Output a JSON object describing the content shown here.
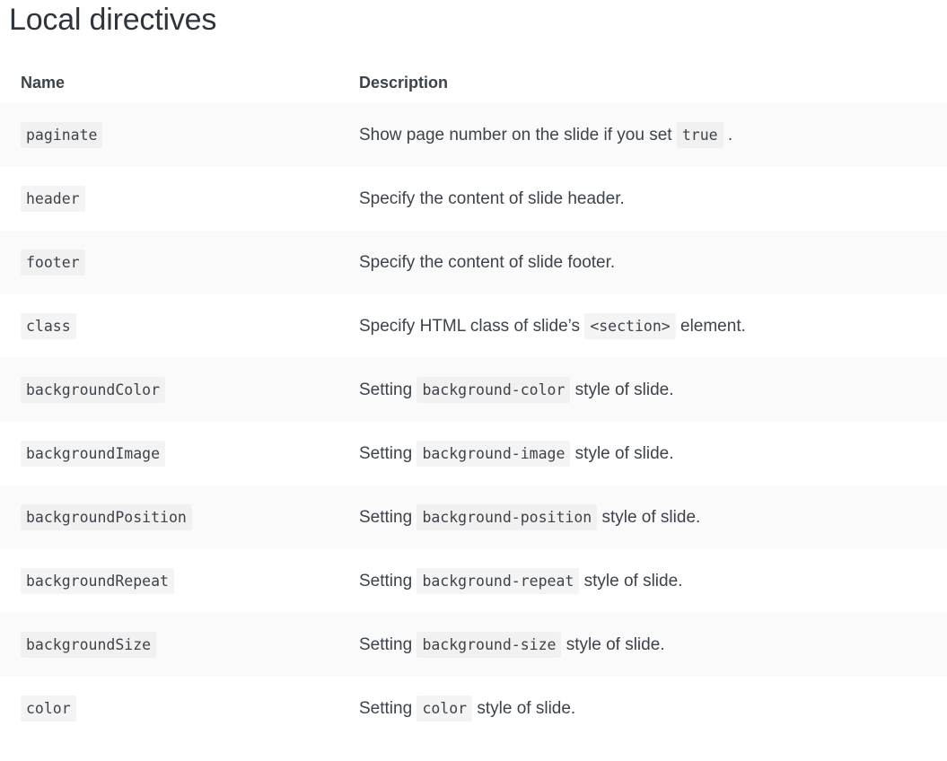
{
  "page": {
    "title": "Local directives"
  },
  "table": {
    "columns": {
      "name": "Name",
      "description": "Description"
    },
    "rows": [
      {
        "name": "paginate",
        "desc_before": "Show page number on the slide if you set ",
        "desc_code": "true",
        "desc_after": " ."
      },
      {
        "name": "header",
        "desc_before": "Specify the content of slide header.",
        "desc_code": "",
        "desc_after": ""
      },
      {
        "name": "footer",
        "desc_before": "Specify the content of slide footer.",
        "desc_code": "",
        "desc_after": ""
      },
      {
        "name": "class",
        "desc_before": "Specify HTML class of slide’s ",
        "desc_code": "<section>",
        "desc_after": " element."
      },
      {
        "name": "backgroundColor",
        "desc_before": "Setting ",
        "desc_code": "background-color",
        "desc_after": " style of slide."
      },
      {
        "name": "backgroundImage",
        "desc_before": "Setting ",
        "desc_code": "background-image",
        "desc_after": " style of slide."
      },
      {
        "name": "backgroundPosition",
        "desc_before": "Setting ",
        "desc_code": "background-position",
        "desc_after": " style of slide."
      },
      {
        "name": "backgroundRepeat",
        "desc_before": "Setting ",
        "desc_code": "background-repeat",
        "desc_after": " style of slide."
      },
      {
        "name": "backgroundSize",
        "desc_before": "Setting ",
        "desc_code": "background-size",
        "desc_after": " style of slide."
      },
      {
        "name": "color",
        "desc_before": "Setting ",
        "desc_code": "color",
        "desc_after": " style of slide."
      }
    ]
  },
  "colors": {
    "page_background": "#ffffff",
    "row_stripe": "#fafafa",
    "code_chip_background": "#f4f4f4",
    "text": "#3d434b",
    "title": "#2f353c"
  }
}
